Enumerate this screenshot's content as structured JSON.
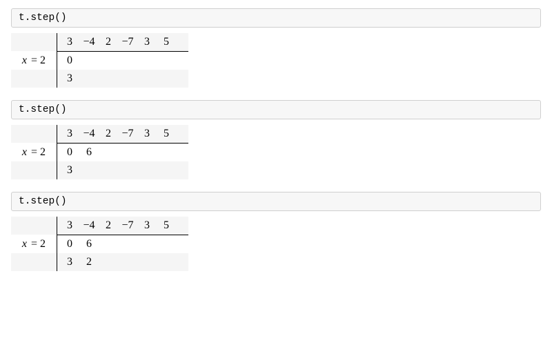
{
  "blocks": [
    {
      "code": "t.step()",
      "x_label": "x = 2",
      "coeffs": [
        "3",
        "−4",
        "2",
        "−7",
        "3",
        "5"
      ],
      "row2": [
        "0",
        "",
        "",
        "",
        "",
        ""
      ],
      "row3": [
        "3",
        "",
        "",
        "",
        "",
        ""
      ]
    },
    {
      "code": "t.step()",
      "x_label": "x = 2",
      "coeffs": [
        "3",
        "−4",
        "2",
        "−7",
        "3",
        "5"
      ],
      "row2": [
        "0",
        "6",
        "",
        "",
        "",
        ""
      ],
      "row3": [
        "3",
        "",
        "",
        "",
        "",
        ""
      ]
    },
    {
      "code": "t.step()",
      "x_label": "x = 2",
      "coeffs": [
        "3",
        "−4",
        "2",
        "−7",
        "3",
        "5"
      ],
      "row2": [
        "0",
        "6",
        "",
        "",
        "",
        ""
      ],
      "row3": [
        "3",
        "2",
        "",
        "",
        "",
        ""
      ]
    }
  ]
}
